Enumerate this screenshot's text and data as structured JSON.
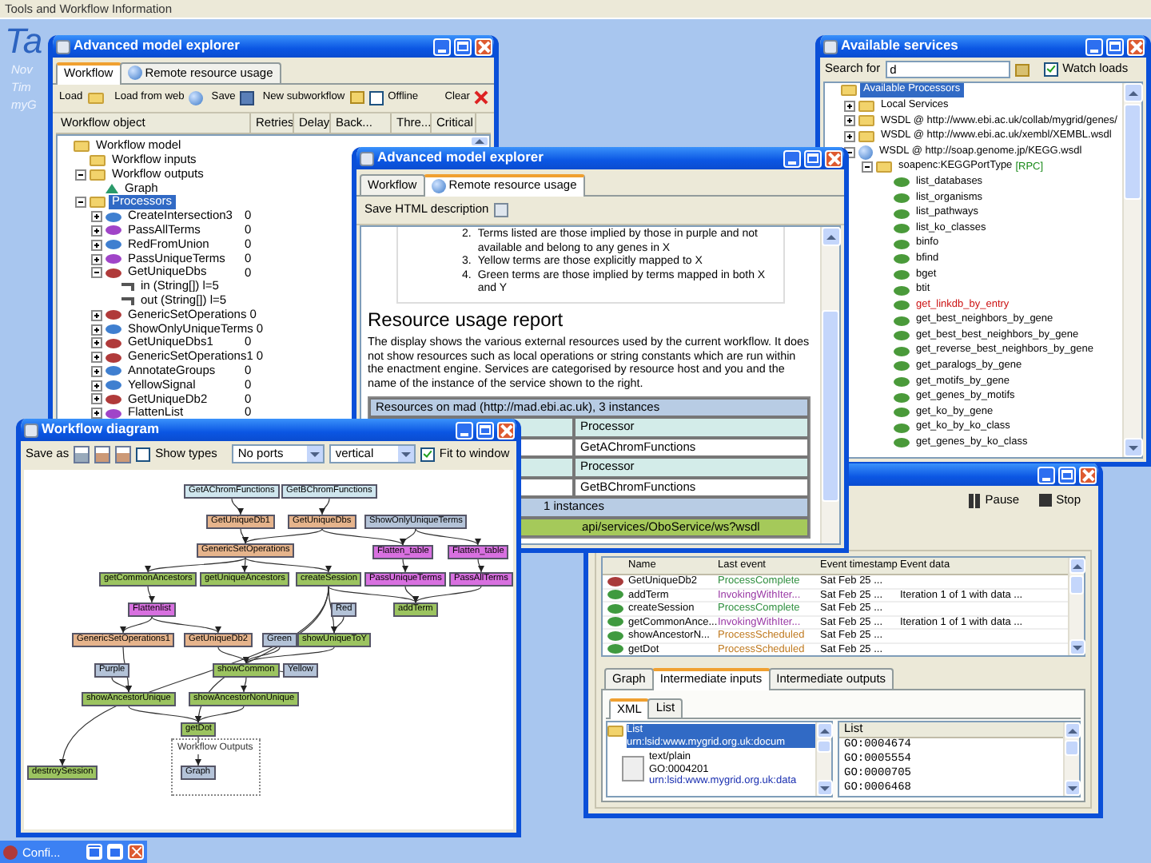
{
  "top_bar": {
    "title": "Tools and Workflow Information"
  },
  "desktop": {
    "logo": "Ta",
    "lines": [
      "Nov",
      "Tim",
      "myG"
    ]
  },
  "explorer_back": {
    "title": "Advanced model explorer",
    "tabs": [
      {
        "label": "Workflow",
        "selected": true
      },
      {
        "label": "Remote resource usage",
        "selected": false
      }
    ],
    "toolbar": [
      {
        "kind": "button",
        "label": "Load"
      },
      {
        "kind": "button",
        "label": "Load from web"
      },
      {
        "kind": "button",
        "label": "Save"
      },
      {
        "kind": "button",
        "label": "New subworkflow"
      },
      {
        "kind": "checkbox",
        "label": "Offline",
        "checked": false
      },
      {
        "kind": "button",
        "label": "Clear"
      }
    ],
    "columns": [
      "Workflow object",
      "Retries",
      "Delay",
      "Back...",
      "Thre...",
      "Critical"
    ],
    "tree": [
      {
        "label": "Workflow model",
        "kind": "folder",
        "selected": false,
        "children": [
          {
            "label": "Workflow inputs",
            "kind": "folder",
            "selected": false
          },
          {
            "label": "Workflow outputs",
            "kind": "folder",
            "expanded": true,
            "selected": false,
            "children": [
              {
                "label": "Graph",
                "kind": "output",
                "selected": false
              }
            ]
          },
          {
            "label": "Processors",
            "kind": "folder",
            "expanded": true,
            "selected": true,
            "children": [
              {
                "label": "CreateIntersection3",
                "kind": "processor",
                "color": "#3f7fd0",
                "expanded": false,
                "selected": false,
                "retries": "0"
              },
              {
                "label": "PassAllTerms",
                "kind": "processor",
                "color": "#a044c8",
                "expanded": false,
                "selected": false,
                "retries": "0"
              },
              {
                "label": "RedFromUnion",
                "kind": "processor",
                "color": "#3f7fd0",
                "expanded": false,
                "selected": false,
                "retries": "0"
              },
              {
                "label": "PassUniqueTerms",
                "kind": "processor",
                "color": "#a044c8",
                "expanded": false,
                "selected": false,
                "retries": "0"
              },
              {
                "label": "GetUniqueDbs",
                "kind": "processor",
                "color": "#b03a3a",
                "expanded": true,
                "selected": false,
                "retries": "0",
                "children": [
                  {
                    "label": "in (String[]) l=5",
                    "kind": "port",
                    "selected": false
                  },
                  {
                    "label": "out (String[]) l=5",
                    "kind": "port",
                    "selected": false
                  }
                ]
              },
              {
                "label": "GenericSetOperations",
                "kind": "processor",
                "color": "#b03a3a",
                "expanded": false,
                "selected": false,
                "retries": "0"
              },
              {
                "label": "ShowOnlyUniqueTerms",
                "kind": "processor",
                "color": "#3f7fd0",
                "expanded": false,
                "selected": false,
                "retries": "0"
              },
              {
                "label": "GetUniqueDbs1",
                "kind": "processor",
                "color": "#b03a3a",
                "expanded": false,
                "selected": false,
                "retries": "0"
              },
              {
                "label": "GenericSetOperations1",
                "kind": "processor",
                "color": "#b03a3a",
                "expanded": false,
                "selected": false,
                "retries": "0"
              },
              {
                "label": "AnnotateGroups",
                "kind": "processor",
                "color": "#3f7fd0",
                "expanded": false,
                "selected": false,
                "retries": "0"
              },
              {
                "label": "YellowSignal",
                "kind": "processor",
                "color": "#3f7fd0",
                "expanded": false,
                "selected": false,
                "retries": "0"
              },
              {
                "label": "GetUniqueDb2",
                "kind": "processor",
                "color": "#b03a3a",
                "expanded": false,
                "selected": false,
                "retries": "0"
              },
              {
                "label": "FlattenList",
                "kind": "processor",
                "color": "#a044c8",
                "expanded": false,
                "selected": false,
                "retries": "0"
              }
            ]
          }
        ]
      }
    ]
  },
  "services": {
    "title": "Available services",
    "search": {
      "label": "Search for",
      "value": "d"
    },
    "watch": {
      "label": "Watch loads",
      "checked": true
    },
    "tree": [
      {
        "label": "Available Processors",
        "kind": "folder",
        "selected": true,
        "children": [
          {
            "label": "Local Services",
            "kind": "folder",
            "expanded": false,
            "selected": false
          },
          {
            "label": "WSDL @ http://www.ebi.ac.uk/collab/mygrid/genes/",
            "kind": "folder",
            "expanded": false,
            "selected": false
          },
          {
            "label": "WSDL @ http://www.ebi.ac.uk/xembl/XEMBL.wsdl",
            "kind": "folder",
            "expanded": false,
            "selected": false
          },
          {
            "label": "WSDL @ http://soap.genome.jp/KEGG.wsdl",
            "kind": "wsdl",
            "expanded": true,
            "selected": false,
            "children": [
              {
                "label": "soapenc:KEGGPortType",
                "tag": "[RPC]",
                "kind": "folder",
                "expanded": true,
                "selected": false,
                "children": [
                  {
                    "label": "list_databases",
                    "kind": "operation",
                    "color": "#000000",
                    "selected": false
                  },
                  {
                    "label": "list_organisms",
                    "kind": "operation",
                    "color": "#000000",
                    "selected": false
                  },
                  {
                    "label": "list_pathways",
                    "kind": "operation",
                    "color": "#000000",
                    "selected": false
                  },
                  {
                    "label": "list_ko_classes",
                    "kind": "operation",
                    "color": "#000000",
                    "selected": false
                  },
                  {
                    "label": "binfo",
                    "kind": "operation",
                    "color": "#000000",
                    "selected": false
                  },
                  {
                    "label": "bfind",
                    "kind": "operation",
                    "color": "#000000",
                    "selected": false
                  },
                  {
                    "label": "bget",
                    "kind": "operation",
                    "color": "#000000",
                    "selected": false
                  },
                  {
                    "label": "btit",
                    "kind": "operation",
                    "color": "#000000",
                    "selected": false
                  },
                  {
                    "label": "get_linkdb_by_entry",
                    "kind": "operation",
                    "color": "#cc1111",
                    "selected": false
                  },
                  {
                    "label": "get_best_neighbors_by_gene",
                    "kind": "operation",
                    "color": "#000000",
                    "selected": false
                  },
                  {
                    "label": "get_best_best_neighbors_by_gene",
                    "kind": "operation",
                    "color": "#000000",
                    "selected": false
                  },
                  {
                    "label": "get_reverse_best_neighbors_by_gene",
                    "kind": "operation",
                    "color": "#000000",
                    "selected": false
                  },
                  {
                    "label": "get_paralogs_by_gene",
                    "kind": "operation",
                    "color": "#000000",
                    "selected": false
                  },
                  {
                    "label": "get_motifs_by_gene",
                    "kind": "operation",
                    "color": "#000000",
                    "selected": false
                  },
                  {
                    "label": "get_genes_by_motifs",
                    "kind": "operation",
                    "color": "#000000",
                    "selected": false
                  },
                  {
                    "label": "get_ko_by_gene",
                    "kind": "operation",
                    "color": "#000000",
                    "selected": false
                  },
                  {
                    "label": "get_ko_by_ko_class",
                    "kind": "operation",
                    "color": "#000000",
                    "selected": false
                  },
                  {
                    "label": "get_genes_by_ko_class",
                    "kind": "operation",
                    "color": "#000000",
                    "selected": false
                  }
                ]
              }
            ]
          }
        ]
      }
    ]
  },
  "run": {
    "controls": [
      {
        "label": "Pause"
      },
      {
        "label": "Stop"
      }
    ],
    "columns": [
      "Name",
      "Last event",
      "Event timestamp",
      "Event data"
    ],
    "rows": [
      {
        "name": "GetUniqueDb2",
        "icon": {
          "color": "#a83a3a"
        },
        "event": {
          "text": "ProcessComplete",
          "color": "#2f8f3f"
        },
        "timestamp": "Sat Feb 25 ..."
      },
      {
        "name": "addTerm",
        "icon": {
          "color": "#3f9a3f"
        },
        "event": {
          "text": "InvokingWithIter...",
          "color": "#9a3aa6"
        },
        "timestamp": "Sat Feb 25 ...",
        "data": "Iteration 1 of 1 with data ..."
      },
      {
        "name": "createSession",
        "icon": {
          "color": "#3f9a3f"
        },
        "event": {
          "text": "ProcessComplete",
          "color": "#2f8f3f"
        },
        "timestamp": "Sat Feb 25 ..."
      },
      {
        "name": "getCommonAnce...",
        "icon": {
          "color": "#3f9a3f"
        },
        "event": {
          "text": "InvokingWithIter...",
          "color": "#9a3aa6"
        },
        "timestamp": "Sat Feb 25 ...",
        "data": "Iteration 1 of 1 with data ..."
      },
      {
        "name": "showAncestorN...",
        "icon": {
          "color": "#3f9a3f"
        },
        "event": {
          "text": "ProcessScheduled",
          "color": "#c07a20"
        },
        "timestamp": "Sat Feb 25 ..."
      },
      {
        "name": "getDot",
        "icon": {
          "color": "#3f9a3f"
        },
        "event": {
          "text": "ProcessScheduled",
          "color": "#c07a20"
        },
        "timestamp": "Sat Feb 25 ..."
      }
    ],
    "tabs": [
      {
        "label": "Graph",
        "selected": false
      },
      {
        "label": "Intermediate inputs",
        "selected": true
      },
      {
        "label": "Intermediate outputs",
        "selected": false
      }
    ],
    "subtabs": [
      {
        "label": "XML",
        "selected": true
      },
      {
        "label": "List",
        "selected": false
      }
    ],
    "data_tree": [
      {
        "kind": "folder",
        "selected": true,
        "name": "List",
        "uri": "urn:lsid:www.mygrid.org.uk:docum"
      },
      {
        "kind": "document",
        "selected": false,
        "mime": "text/plain",
        "name": "GO:0004201",
        "uri": "urn:lsid:www.mygrid.org.uk:data"
      }
    ],
    "list_header": "List",
    "values": [
      "GO:0004674",
      "GO:0005554",
      "GO:0000705",
      "GO:0006468"
    ]
  },
  "explorer_front": {
    "title": "Advanced model explorer",
    "tabs": [
      {
        "label": "Workflow",
        "selected": false
      },
      {
        "label": "Remote resource usage",
        "selected": true
      }
    ],
    "toolbar": [
      {
        "label": "Save HTML description"
      }
    ],
    "legend": [
      {
        "marker": "2.",
        "text": "Terms listed are those implied by those in purple and not available and belong to any genes in X"
      },
      {
        "marker": "3.",
        "text": "Yellow terms are those explicitly mapped to X"
      },
      {
        "marker": "4.",
        "text": "Green terms are those implied by terms mapped in both X and Y"
      }
    ],
    "heading": "Resource usage report",
    "intro": "The display shows the various external resources used by the current workflow. It does not show resources such as local operations or string constants which are run within the enactment engine. Services are categorised by resource host and you and the name of the instance of the service shown to the right.",
    "resources": [
      {
        "kind": "group",
        "text": "Resources on mad (http://mad.ebi.ac.uk), 3 instances"
      },
      {
        "kind": "head",
        "text": "Processor"
      },
      {
        "kind": "item",
        "text": "GetAChromFunctions"
      },
      {
        "kind": "head",
        "text": "Processor"
      },
      {
        "kind": "item",
        "text": "GetBChromFunctions"
      },
      {
        "kind": "group",
        "text": "1 instances"
      },
      {
        "kind": "endpoint",
        "text": "api/services/OboService/ws?wsdl"
      }
    ]
  },
  "diagram": {
    "title": "Workflow diagram",
    "save_label": "Save as",
    "show_types": {
      "label": "Show types",
      "checked": false
    },
    "ports": {
      "value": "No ports"
    },
    "orientation": {
      "value": "vertical"
    },
    "fit": {
      "label": "Fit to window",
      "checked": true
    },
    "nodes": [
      {
        "label": "GetAChromFunctions",
        "color": "#cfe6ee"
      },
      {
        "label": "GetBChromFunctions",
        "color": "#cfe6ee"
      },
      {
        "label": "GetUniqueDb1",
        "color": "#e6b48c"
      },
      {
        "label": "GetUniqueDbs",
        "color": "#e6b48c"
      },
      {
        "label": "ShowOnlyUniqueTerms",
        "color": "#b4c3d8"
      },
      {
        "label": "GenericSetOperations",
        "color": "#e6b48c"
      },
      {
        "label": "Flatten_table",
        "color": "#d870e0"
      },
      {
        "label": "Flatten_table",
        "color": "#d870e0"
      },
      {
        "label": "getCommonAncestors",
        "color": "#9cc460"
      },
      {
        "label": "getUniqueAncestors",
        "color": "#9cc460"
      },
      {
        "label": "createSession",
        "color": "#9cc460"
      },
      {
        "label": "PassUniqueTerms",
        "color": "#d870e0"
      },
      {
        "label": "PassAllTerms",
        "color": "#d870e0"
      },
      {
        "label": "Flattenlist",
        "color": "#d870e0"
      },
      {
        "label": "Red",
        "color": "#b4c3d8"
      },
      {
        "label": "addTerm",
        "color": "#9cc460"
      },
      {
        "label": "GenericSetOperations1",
        "color": "#e6b48c"
      },
      {
        "label": "GetUniqueDb2",
        "color": "#e6b48c"
      },
      {
        "label": "Green",
        "color": "#b4c3d8"
      },
      {
        "label": "showUniqueToY",
        "color": "#9cc460"
      },
      {
        "label": "Purple",
        "color": "#b4c3d8"
      },
      {
        "label": "showCommon",
        "color": "#9cc460"
      },
      {
        "label": "Yellow",
        "color": "#b4c3d8"
      },
      {
        "label": "showAncestorUnique",
        "color": "#9cc460"
      },
      {
        "label": "showAncestorNonUnique",
        "color": "#9cc460"
      },
      {
        "label": "getDot",
        "color": "#9cc460"
      },
      {
        "label": "destroySession",
        "color": "#9cc460"
      },
      {
        "label": "Graph",
        "color": "#b4c3d8"
      }
    ],
    "outputs_label": "Workflow Outputs"
  },
  "taskbar": {
    "label": "Confi..."
  }
}
